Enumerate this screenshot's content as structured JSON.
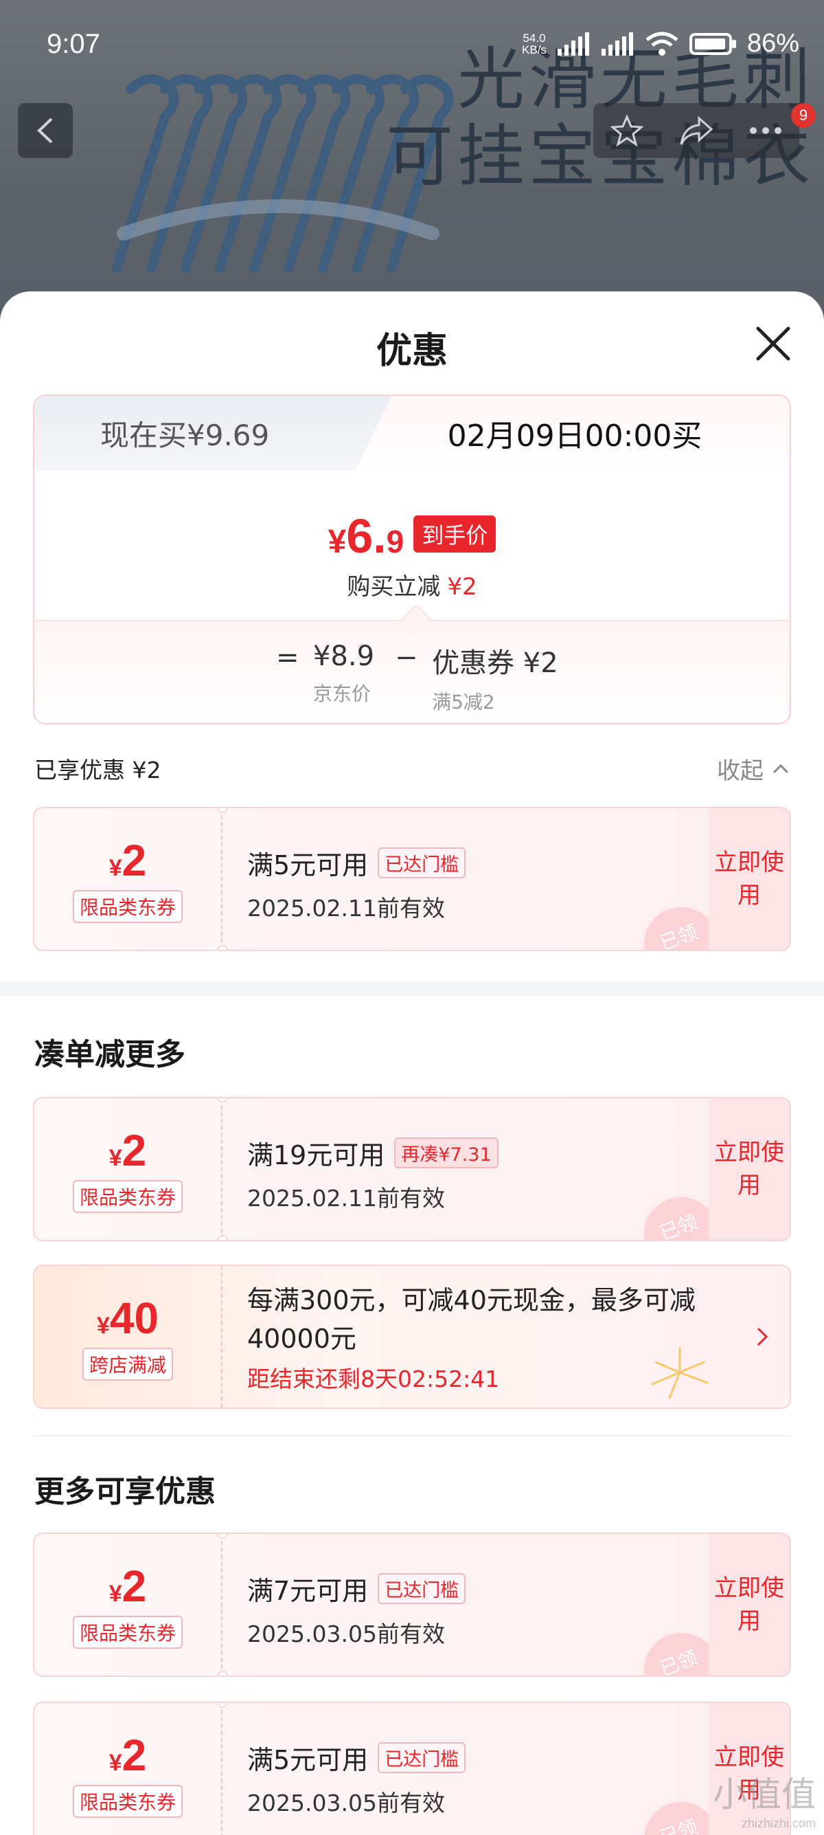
{
  "status_bar": {
    "time": "9:07",
    "net_speed_value": "54.0",
    "net_speed_unit": "KB/s",
    "battery": "86%"
  },
  "background": {
    "line1": "光滑无毛刺",
    "line2": "可挂宝宝棉衣",
    "notification_count": "9"
  },
  "sheet": {
    "title": "优惠",
    "tab_now": "现在买¥9.69",
    "tab_future": "02月09日00:00买",
    "final_price": {
      "currency": "¥",
      "integer": "6.",
      "decimal": "9"
    },
    "final_price_tag": "到手价",
    "instant_cut_label": "购买立减",
    "instant_cut_amount": "¥2",
    "calc": {
      "eq": "=",
      "jd_price": "¥8.9",
      "jd_price_label": "京东价",
      "minus": "−",
      "coupon": "优惠券 ¥2",
      "coupon_rule": "满5减2"
    },
    "enjoyed": "已享优惠 ¥2",
    "collapse": "收起"
  },
  "coupons_enjoyed": [
    {
      "currency": "¥",
      "amount": "2",
      "type": "限品类东券",
      "condition": "满5元可用",
      "state": "已达门槛",
      "valid": "2025.02.11前有效",
      "action": "立即使用",
      "stamp": "已领"
    }
  ],
  "section_more_order": {
    "title": "凑单减更多",
    "coupon": {
      "currency": "¥",
      "amount": "2",
      "type": "限品类东券",
      "condition": "满19元可用",
      "state": "再凑¥7.31",
      "valid": "2025.02.11前有效",
      "action": "立即使用",
      "stamp": "已领"
    },
    "cross_store": {
      "currency": "¥",
      "amount": "40",
      "type": "跨店满减",
      "desc": "每满300元，可减40元现金，最多可减40000元",
      "countdown": "距结束还剩8天02:52:41"
    }
  },
  "section_more_discounts": {
    "title": "更多可享优惠",
    "coupons": [
      {
        "currency": "¥",
        "amount": "2",
        "type": "限品类东券",
        "condition": "满7元可用",
        "state": "已达门槛",
        "valid": "2025.03.05前有效",
        "action": "立即使用",
        "stamp": "已领"
      },
      {
        "currency": "¥",
        "amount": "2",
        "type": "限品类东券",
        "condition": "满5元可用",
        "state": "已达门槛",
        "valid": "2025.03.05前有效",
        "action": "立即使用",
        "stamp": "已领"
      }
    ]
  },
  "watermark": {
    "brand": "小值值",
    "domain": "zhizhizhi.com"
  },
  "colors": {
    "accent_red": "#e8262c",
    "coupon_bg": "#fff6f7",
    "overlay": "#5a6068"
  }
}
